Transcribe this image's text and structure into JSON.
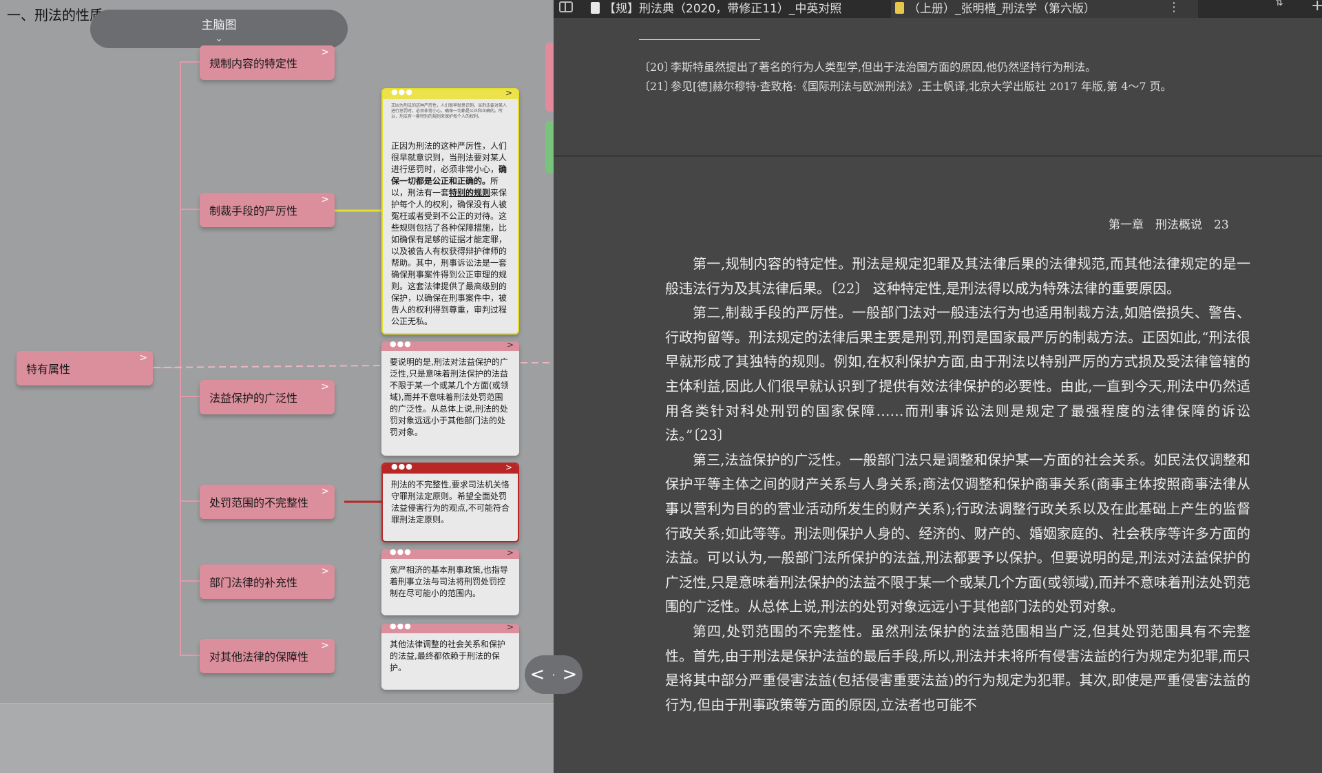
{
  "left": {
    "breadcrumb": "一、刑法的性质",
    "mindmap_tab": {
      "label": "主脑图"
    },
    "root": {
      "label": "特有属性"
    },
    "branches": [
      {
        "label": "规制内容的特定性"
      },
      {
        "label": "制裁手段的严厉性"
      },
      {
        "label": "法益保护的广泛性"
      },
      {
        "label": "处罚范围的不完整性"
      },
      {
        "label": "部门法律的补充性"
      },
      {
        "label": "对其他法律的保障性"
      }
    ],
    "cards": [
      {
        "color": "#ece24c",
        "mini_text": "正因为刑法的这种严厉性，人们很早就意识到，当刑法要对某人进行惩罚时，必须非常小心，确保一切都是公正和正确的。所以，刑法有一套特别的规则来保护每个人的权利。",
        "pre": "正因为刑法的这种严厉性，人们很早就意识到，当刑法要对某人进行惩罚时，必须非常小心，",
        "bold1": "确保一切都是公正和正确的。",
        "mid": "所以，刑法有一套",
        "bold2": "特别的规则",
        "post": "来保护每个人的权利，确保没有人被冤枉或者受到不公正的对待。这些规则包括了各种保障措施，比如确保有足够的证据才能定罪，以及被告人有权获得辩护律师的帮助。其中，刑事诉讼法是一套确保刑事案件得到公正审理的规则。这套法律提供了最高级别的保护，以确保在刑事案件中，被告人的权利得到尊重，审判过程公正无私。"
      },
      {
        "color": "#db8e9c",
        "text": "要说明的是,刑法对法益保护的广泛性,只是意味着刑法保护的法益不限于某一个或某几个方面(或领域),而并不意味着刑法处罚范围的广泛性。从总体上说,刑法的处罚对象远远小于其他部门法的处罚对象。"
      },
      {
        "color": "#b92626",
        "text": "刑法的不完整性,要求司法机关恪守罪刑法定原则。希望全面处罚法益侵害行为的观点,不可能符合罪刑法定原则。"
      },
      {
        "color": "#db8e9c",
        "text": "宽严相济的基本刑事政策,也指导着刑事立法与司法将刑罚处罚控制在尽可能小的范围内。"
      },
      {
        "color": "#db8e9c",
        "text": "其他法律调整的社会关系和保护的法益,最终都依赖于刑法的保护。"
      }
    ],
    "pager": {
      "prev": "<",
      "dot": "·",
      "next": ">"
    }
  },
  "reader": {
    "tabs": [
      {
        "label": "【规】刑法典（2020，带修正11）_中英对照",
        "icon_color": "#e8e8e8"
      },
      {
        "label": "（上册）_张明楷_刑法学（第六版）",
        "icon_color": "#e6c84a"
      }
    ],
    "toolbar": {
      "more": "⋮",
      "sort": "⇅",
      "add": "+"
    },
    "footnotes": [
      {
        "num": "〔20〕",
        "text": "李斯特虽然提出了著名的行为人类型学,但出于法治国方面的原因,他仍然坚持行为刑法。"
      },
      {
        "num": "〔21〕",
        "text": "参见[德]赫尔穆特·查致格:《国际刑法与欧洲刑法》,王士帆译,北京大学出版社 2017 年版,第 4～7 页。"
      }
    ],
    "running_head": "第一章　刑法概说　23",
    "paragraphs": [
      "第一,规制内容的特定性。刑法是规定犯罪及其法律后果的法律规范,而其他法律规定的是一般违法行为及其法律后果。〔22〕 这种特定性,是刑法得以成为特殊法律的重要原因。",
      "第二,制裁手段的严厉性。一般部门法对一般违法行为也适用制裁方法,如赔偿损失、警告、行政拘留等。刑法规定的法律后果主要是刑罚,刑罚是国家最严厉的制裁方法。正因如此,“刑法很早就形成了其独特的规则。例如,在权利保护方面,由于刑法以特别严厉的方式损及受法律管辖的主体利益,因此人们很早就认识到了提供有效法律保护的必要性。由此,一直到今天,刑法中仍然适用各类针对科处刑罚的国家保障……而刑事诉讼法则是规定了最强程度的法律保障的诉讼法。”〔23〕",
      "第三,法益保护的广泛性。一般部门法只是调整和保护某一方面的社会关系。如民法仅调整和保护平等主体之间的财产关系与人身关系;商法仅调整和保护商事关系(商事主体按照商事法律从事以营利为目的的营业活动所发生的财产关系);行政法调整行政关系以及在此基础上产生的监督行政关系;如此等等。刑法则保护人身的、经济的、财产的、婚姻家庭的、社会秩序等许多方面的法益。可以认为,一般部门法所保护的法益,刑法都要予以保护。但要说明的是,刑法对法益保护的广泛性,只是意味着刑法保护的法益不限于某一个或某几个方面(或领域),而并不意味着刑法处罚范围的广泛性。从总体上说,刑法的处罚对象远远小于其他部门法的处罚对象。",
      "第四,处罚范围的不完整性。虽然刑法保护的法益范围相当广泛,但其处罚范围具有不完整性。首先,由于刑法是保护法益的最后手段,所以,刑法并未将所有侵害法益的行为规定为犯罪,而只是将其中部分严重侵害法益(包括侵害重要法益)的行为规定为犯罪。其次,即使是严重侵害法益的行为,但由于刑事政策等方面的原因,立法者也可能不"
    ]
  }
}
